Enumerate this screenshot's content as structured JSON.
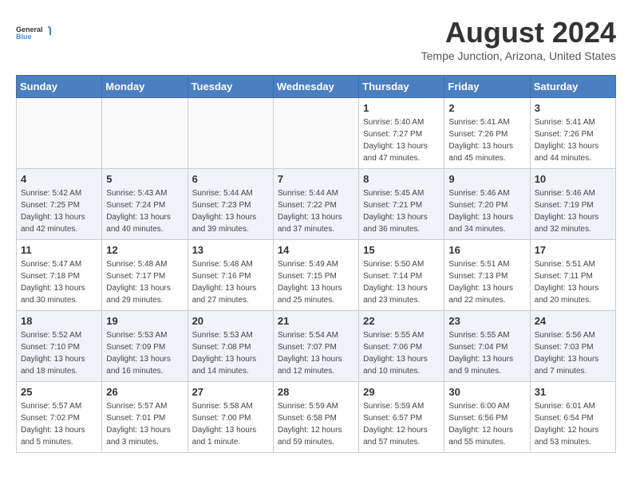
{
  "header": {
    "logo_line1": "General",
    "logo_line2": "Blue",
    "month": "August 2024",
    "location": "Tempe Junction, Arizona, United States"
  },
  "weekdays": [
    "Sunday",
    "Monday",
    "Tuesday",
    "Wednesday",
    "Thursday",
    "Friday",
    "Saturday"
  ],
  "weeks": [
    [
      {
        "day": "",
        "info": ""
      },
      {
        "day": "",
        "info": ""
      },
      {
        "day": "",
        "info": ""
      },
      {
        "day": "",
        "info": ""
      },
      {
        "day": "1",
        "info": "Sunrise: 5:40 AM\nSunset: 7:27 PM\nDaylight: 13 hours\nand 47 minutes."
      },
      {
        "day": "2",
        "info": "Sunrise: 5:41 AM\nSunset: 7:26 PM\nDaylight: 13 hours\nand 45 minutes."
      },
      {
        "day": "3",
        "info": "Sunrise: 5:41 AM\nSunset: 7:26 PM\nDaylight: 13 hours\nand 44 minutes."
      }
    ],
    [
      {
        "day": "4",
        "info": "Sunrise: 5:42 AM\nSunset: 7:25 PM\nDaylight: 13 hours\nand 42 minutes."
      },
      {
        "day": "5",
        "info": "Sunrise: 5:43 AM\nSunset: 7:24 PM\nDaylight: 13 hours\nand 40 minutes."
      },
      {
        "day": "6",
        "info": "Sunrise: 5:44 AM\nSunset: 7:23 PM\nDaylight: 13 hours\nand 39 minutes."
      },
      {
        "day": "7",
        "info": "Sunrise: 5:44 AM\nSunset: 7:22 PM\nDaylight: 13 hours\nand 37 minutes."
      },
      {
        "day": "8",
        "info": "Sunrise: 5:45 AM\nSunset: 7:21 PM\nDaylight: 13 hours\nand 36 minutes."
      },
      {
        "day": "9",
        "info": "Sunrise: 5:46 AM\nSunset: 7:20 PM\nDaylight: 13 hours\nand 34 minutes."
      },
      {
        "day": "10",
        "info": "Sunrise: 5:46 AM\nSunset: 7:19 PM\nDaylight: 13 hours\nand 32 minutes."
      }
    ],
    [
      {
        "day": "11",
        "info": "Sunrise: 5:47 AM\nSunset: 7:18 PM\nDaylight: 13 hours\nand 30 minutes."
      },
      {
        "day": "12",
        "info": "Sunrise: 5:48 AM\nSunset: 7:17 PM\nDaylight: 13 hours\nand 29 minutes."
      },
      {
        "day": "13",
        "info": "Sunrise: 5:48 AM\nSunset: 7:16 PM\nDaylight: 13 hours\nand 27 minutes."
      },
      {
        "day": "14",
        "info": "Sunrise: 5:49 AM\nSunset: 7:15 PM\nDaylight: 13 hours\nand 25 minutes."
      },
      {
        "day": "15",
        "info": "Sunrise: 5:50 AM\nSunset: 7:14 PM\nDaylight: 13 hours\nand 23 minutes."
      },
      {
        "day": "16",
        "info": "Sunrise: 5:51 AM\nSunset: 7:13 PM\nDaylight: 13 hours\nand 22 minutes."
      },
      {
        "day": "17",
        "info": "Sunrise: 5:51 AM\nSunset: 7:11 PM\nDaylight: 13 hours\nand 20 minutes."
      }
    ],
    [
      {
        "day": "18",
        "info": "Sunrise: 5:52 AM\nSunset: 7:10 PM\nDaylight: 13 hours\nand 18 minutes."
      },
      {
        "day": "19",
        "info": "Sunrise: 5:53 AM\nSunset: 7:09 PM\nDaylight: 13 hours\nand 16 minutes."
      },
      {
        "day": "20",
        "info": "Sunrise: 5:53 AM\nSunset: 7:08 PM\nDaylight: 13 hours\nand 14 minutes."
      },
      {
        "day": "21",
        "info": "Sunrise: 5:54 AM\nSunset: 7:07 PM\nDaylight: 13 hours\nand 12 minutes."
      },
      {
        "day": "22",
        "info": "Sunrise: 5:55 AM\nSunset: 7:06 PM\nDaylight: 13 hours\nand 10 minutes."
      },
      {
        "day": "23",
        "info": "Sunrise: 5:55 AM\nSunset: 7:04 PM\nDaylight: 13 hours\nand 9 minutes."
      },
      {
        "day": "24",
        "info": "Sunrise: 5:56 AM\nSunset: 7:03 PM\nDaylight: 13 hours\nand 7 minutes."
      }
    ],
    [
      {
        "day": "25",
        "info": "Sunrise: 5:57 AM\nSunset: 7:02 PM\nDaylight: 13 hours\nand 5 minutes."
      },
      {
        "day": "26",
        "info": "Sunrise: 5:57 AM\nSunset: 7:01 PM\nDaylight: 13 hours\nand 3 minutes."
      },
      {
        "day": "27",
        "info": "Sunrise: 5:58 AM\nSunset: 7:00 PM\nDaylight: 13 hours\nand 1 minute."
      },
      {
        "day": "28",
        "info": "Sunrise: 5:59 AM\nSunset: 6:58 PM\nDaylight: 12 hours\nand 59 minutes."
      },
      {
        "day": "29",
        "info": "Sunrise: 5:59 AM\nSunset: 6:57 PM\nDaylight: 12 hours\nand 57 minutes."
      },
      {
        "day": "30",
        "info": "Sunrise: 6:00 AM\nSunset: 6:56 PM\nDaylight: 12 hours\nand 55 minutes."
      },
      {
        "day": "31",
        "info": "Sunrise: 6:01 AM\nSunset: 6:54 PM\nDaylight: 12 hours\nand 53 minutes."
      }
    ]
  ]
}
